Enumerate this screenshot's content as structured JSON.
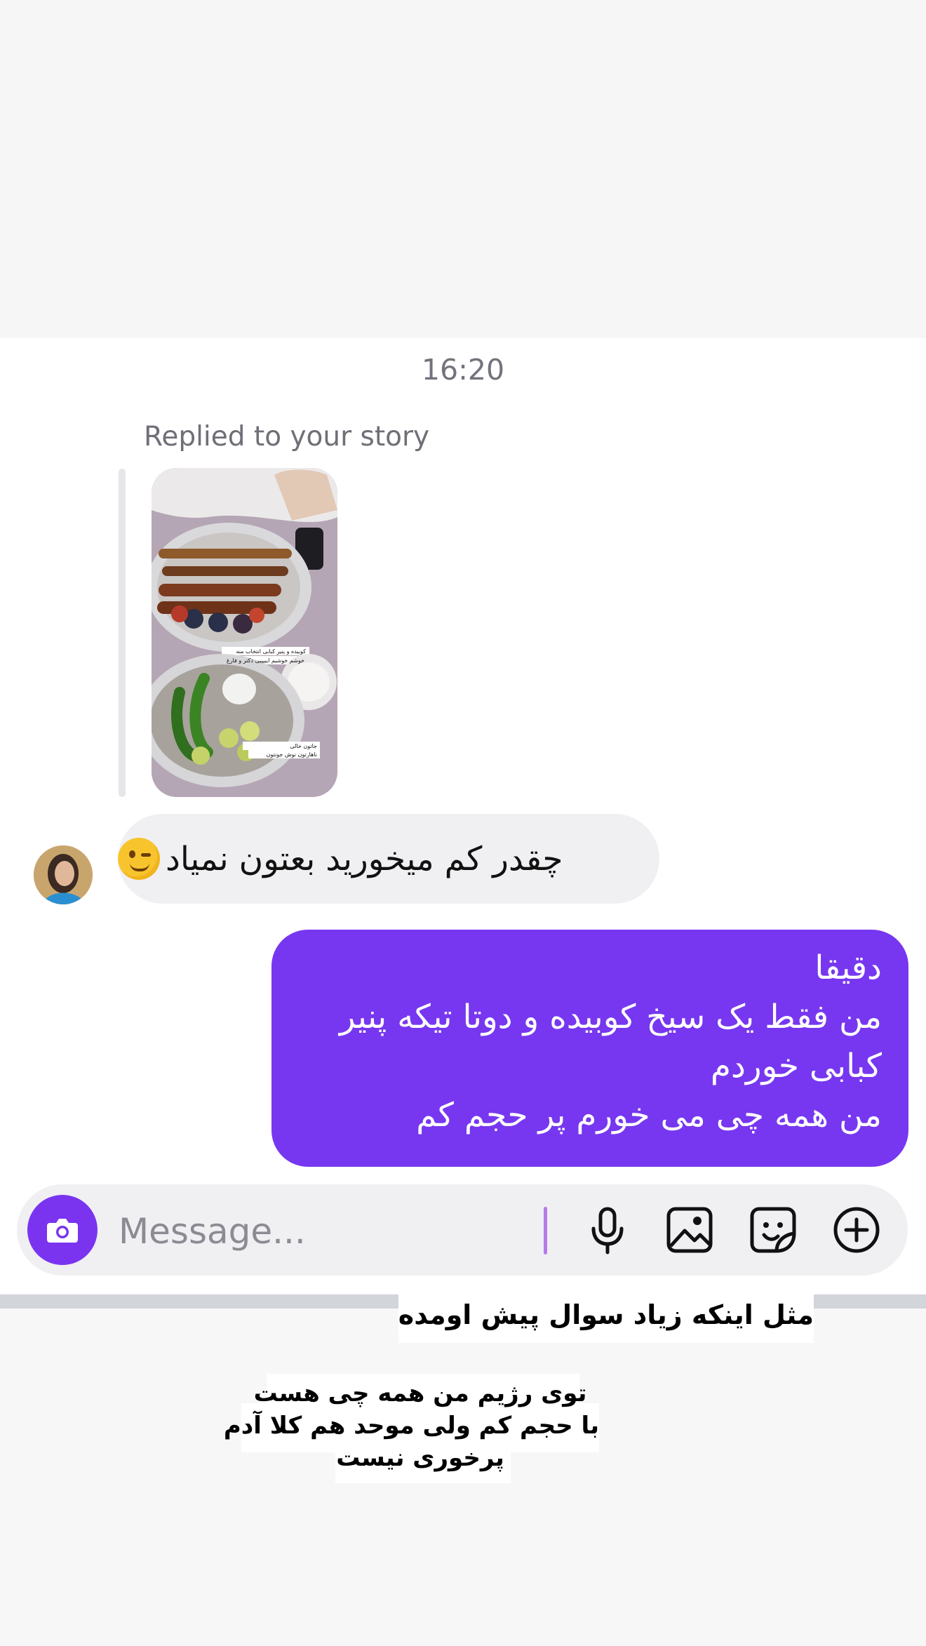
{
  "chat": {
    "timestamp": "16:20",
    "reply_label": "Replied to your story",
    "story": {
      "caption_1": "کوبیده و پنیر کبابی انتخاب منه",
      "caption_2": "خوشم خوشیم ایییییی دکتر و فارغ",
      "caption_3": "جاتون خالی",
      "caption_4": "ناهارتون نوش جونتون"
    },
    "incoming_message": "چقدر کم میخورید بعتون نمیاد",
    "incoming_emoji": "winking-face",
    "outgoing_lines": [
      "دقیقا",
      "من فقط یک سیخ کوبیده و دوتا تیکه پنیر",
      "کبابی خوردم",
      "من همه چی می خورم پر حجم کم"
    ]
  },
  "composer": {
    "placeholder": "Message...",
    "icons": [
      "camera-icon",
      "microphone-icon",
      "image-icon",
      "sticker-icon",
      "plus-icon"
    ]
  },
  "overlay": {
    "headline": "مثل اینکه زیاد سوال پیش اومده",
    "body_lines": [
      "توی رژیم من همه چی هست",
      "با حجم کم ولی موحد هم کلا آدم",
      "پرخوری نیست"
    ]
  },
  "colors": {
    "accent_purple": "#7737f0",
    "incoming_bubble": "#f0f0f3",
    "background": "#f7f7f8"
  }
}
